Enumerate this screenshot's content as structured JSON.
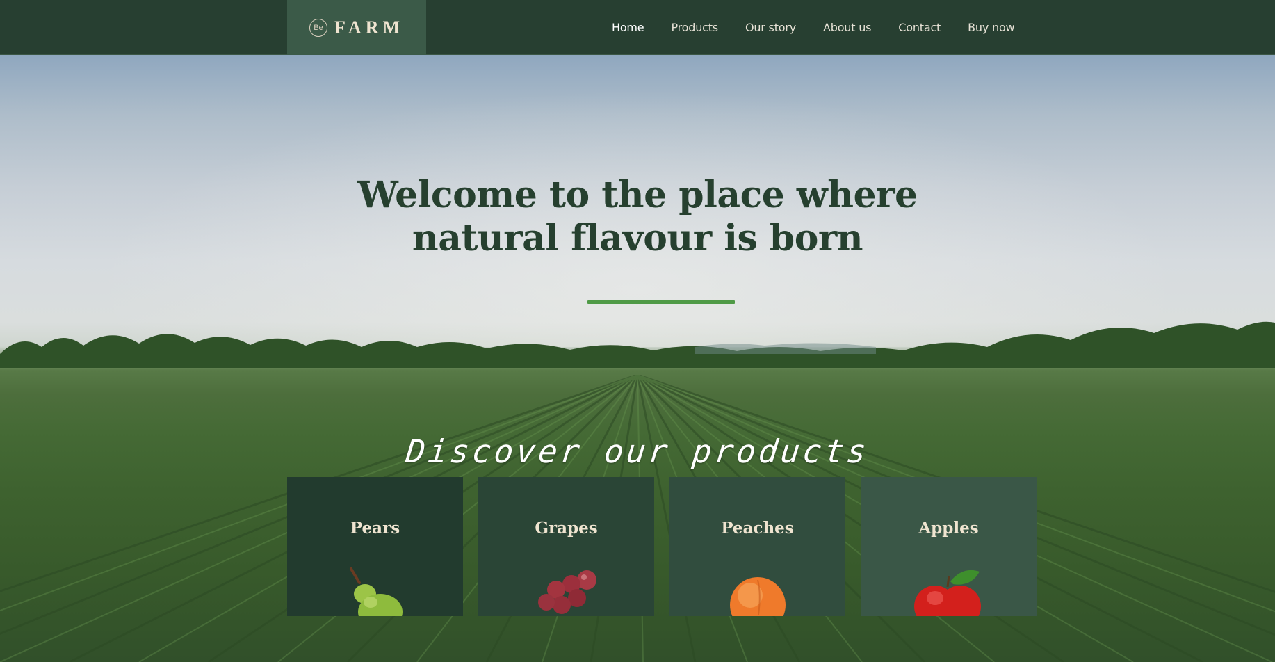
{
  "brand": {
    "mark": "Be",
    "name": "FARM"
  },
  "nav": {
    "items": [
      {
        "label": "Home",
        "active": true
      },
      {
        "label": "Products"
      },
      {
        "label": "Our story"
      },
      {
        "label": "About us"
      },
      {
        "label": "Contact"
      },
      {
        "label": "Buy now"
      }
    ]
  },
  "hero": {
    "title_line1": "Welcome to the place where",
    "title_line2": "natural flavour is born",
    "accent_color": "#4f9a46",
    "subheading": "Discover our products"
  },
  "products": [
    {
      "name": "Pears",
      "icon": "pear-icon",
      "bg": "#223b2e"
    },
    {
      "name": "Grapes",
      "icon": "grapes-icon",
      "bg": "#2a4536"
    },
    {
      "name": "Peaches",
      "icon": "peach-icon",
      "bg": "#314d3e"
    },
    {
      "name": "Apples",
      "icon": "apple-icon",
      "bg": "#3a5747"
    }
  ],
  "colors": {
    "header_bg": "#273f31",
    "logo_box_bg": "#3b5a48",
    "title_color": "#26402f"
  }
}
